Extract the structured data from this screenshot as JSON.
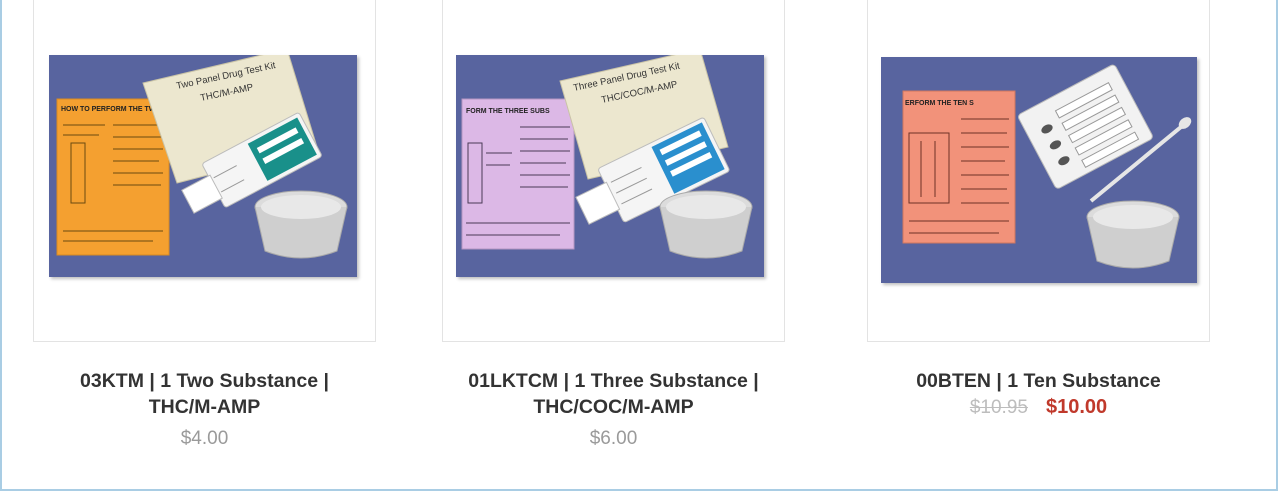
{
  "products": [
    {
      "title_line1": "03KTM | 1 Two Substance |",
      "title_line2": "THC/M-AMP",
      "price": "$4.00",
      "image": {
        "pouch_text_1": "Two Panel Drug Test Kit",
        "pouch_text_2": "THC/M-AMP",
        "sheet_heading": "HOW TO PERFORM THE TWO",
        "sheet_color": "#f4a030",
        "strip_count": 2
      }
    },
    {
      "title_line1": "01LKTCM | 1 Three Substance |",
      "title_line2": "THC/COC/M-AMP",
      "price": "$6.00",
      "image": {
        "pouch_text_1": "Three Panel Drug Test Kit",
        "pouch_text_2": "THC/COC/M-AMP",
        "sheet_heading": "FORM THE THREE SUBS",
        "sheet_color": "#dcb8e6",
        "strip_count": 3
      }
    },
    {
      "title_line1": "00BTEN | 1 Ten Substance",
      "old_price": "$10.95",
      "sale_price": "$10.00",
      "image": {
        "sheet_heading": "ERFORM THE TEN S",
        "sheet_color": "#f2927a"
      }
    }
  ],
  "colors": {
    "photo_background": "#58649f",
    "border": "#a9cde4",
    "sale": "#c0392b"
  }
}
